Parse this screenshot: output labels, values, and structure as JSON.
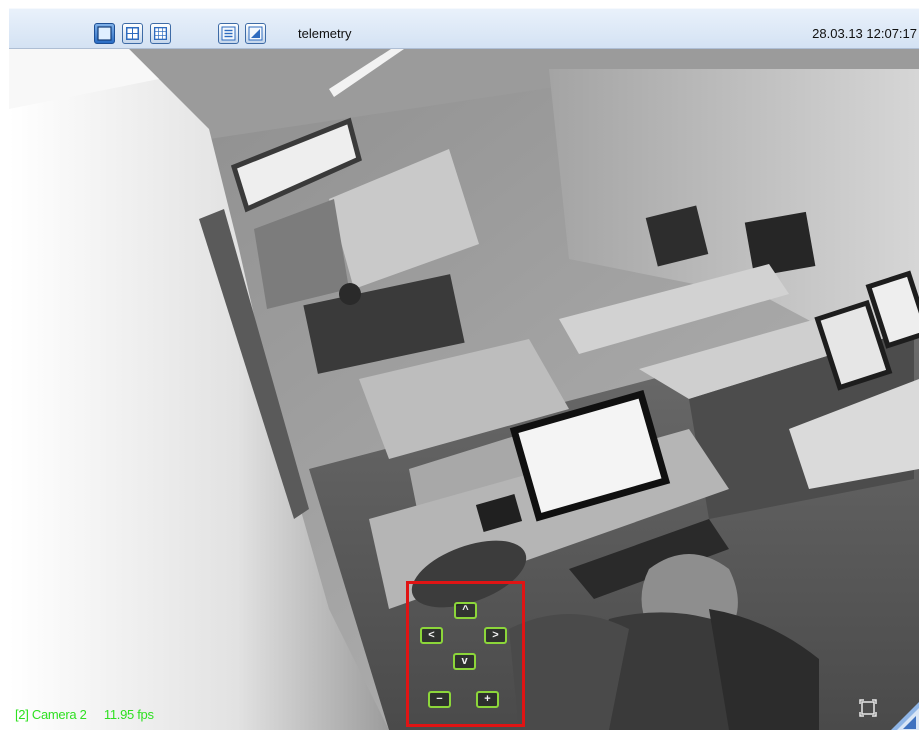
{
  "toolbar": {
    "layout_buttons": [
      {
        "name": "layout-1x1-button",
        "icon": "single-view-icon",
        "active": true
      },
      {
        "name": "layout-2x2-button",
        "icon": "grid-2x2-icon",
        "active": false
      },
      {
        "name": "layout-3x3-button",
        "icon": "grid-3x3-icon",
        "active": false
      }
    ],
    "list_button_icon": "list-icon",
    "telemetry_button_icon": "telemetry-icon",
    "telemetry_label": "telemetry",
    "datetime": "28.03.13 12:07:17"
  },
  "camera": {
    "id_label": "[2] Camera 2",
    "fps_label": "11.95 fps",
    "osd_color": "#2fe021"
  },
  "ptz": {
    "up_label": "^",
    "left_label": "<",
    "right_label": ">",
    "down_label": "v",
    "zoom_out_label": "−",
    "zoom_in_label": "+",
    "button_border_color": "#8cd63a",
    "highlight_color": "#e01414"
  },
  "fullscreen_icon": "fullscreen-icon"
}
